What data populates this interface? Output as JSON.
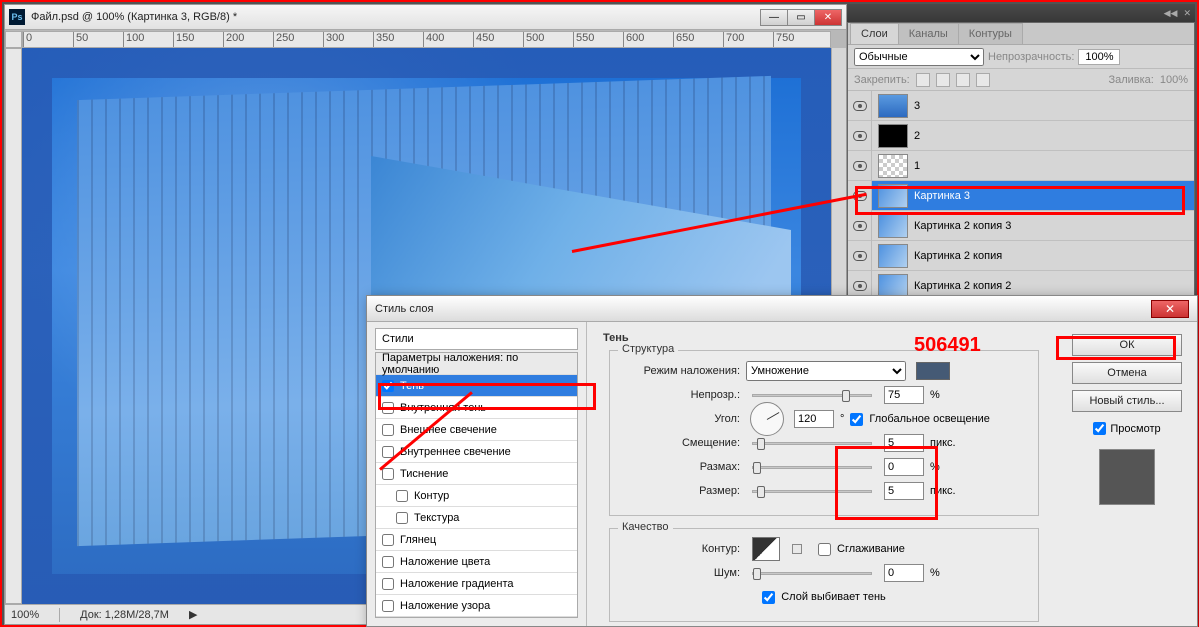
{
  "doc": {
    "title": "Файл.psd @ 100% (Картинка 3, RGB/8) *",
    "zoom": "100%",
    "docsize": "Док: 1,28M/28,7M",
    "ruler_marks": [
      "0",
      "50",
      "100",
      "150",
      "200",
      "250",
      "300",
      "350",
      "400",
      "450",
      "500",
      "550",
      "600",
      "650",
      "700",
      "750"
    ]
  },
  "panel": {
    "tabs": {
      "layers": "Слои",
      "channels": "Каналы",
      "paths": "Контуры"
    },
    "mode_label": "Обычные",
    "opacity_label": "Непрозрачность:",
    "opacity_value": "100%",
    "fill_label": "Заливка:",
    "fill_value": "100%",
    "lock_label": "Закрепить:",
    "layers": [
      {
        "name": "3",
        "thumb": "blue"
      },
      {
        "name": "2",
        "thumb": "black"
      },
      {
        "name": "1",
        "thumb": "checker"
      },
      {
        "name": "Картинка 3",
        "thumb": "img",
        "selected": true
      },
      {
        "name": "Картинка 2 копия 3",
        "thumb": "img"
      },
      {
        "name": "Картинка 2 копия",
        "thumb": "img"
      },
      {
        "name": "Картинка 2 копия 2",
        "thumb": "img"
      }
    ]
  },
  "dlg": {
    "title": "Стиль слоя",
    "left": {
      "styles_head": "Стили",
      "items": [
        {
          "label": "Параметры наложения: по умолчанию",
          "kind": "defaults"
        },
        {
          "label": "Тень",
          "checked": true,
          "selected": true
        },
        {
          "label": "Внутренняя тень"
        },
        {
          "label": "Внешнее свечение"
        },
        {
          "label": "Внутреннее свечение"
        },
        {
          "label": "Тиснение"
        },
        {
          "label": "Контур",
          "indent": true
        },
        {
          "label": "Текстура",
          "indent": true
        },
        {
          "label": "Глянец"
        },
        {
          "label": "Наложение цвета"
        },
        {
          "label": "Наложение градиента"
        },
        {
          "label": "Наложение узора"
        }
      ]
    },
    "mid": {
      "section": "Тень",
      "structure_label": "Структура",
      "blend_label": "Режим наложения:",
      "blend_value": "Умножение",
      "opacity_label": "Непрозр.:",
      "opacity_value": "75",
      "pct": "%",
      "angle_label": "Угол:",
      "angle_value": "120",
      "deg": "°",
      "global_light": "Глобальное освещение",
      "distance_label": "Смещение:",
      "distance_value": "5",
      "px": "пикс.",
      "spread_label": "Размах:",
      "spread_value": "0",
      "size_label": "Размер:",
      "size_value": "5",
      "quality_label": "Качество",
      "contour_label": "Контур:",
      "antialias": "Сглаживание",
      "noise_label": "Шум:",
      "noise_value": "0",
      "knockout": "Слой выбивает тень"
    },
    "right": {
      "ok": "ОК",
      "cancel": "Отмена",
      "new_style": "Новый стиль...",
      "preview": "Просмотр"
    }
  },
  "annotation": {
    "id": "506491"
  }
}
